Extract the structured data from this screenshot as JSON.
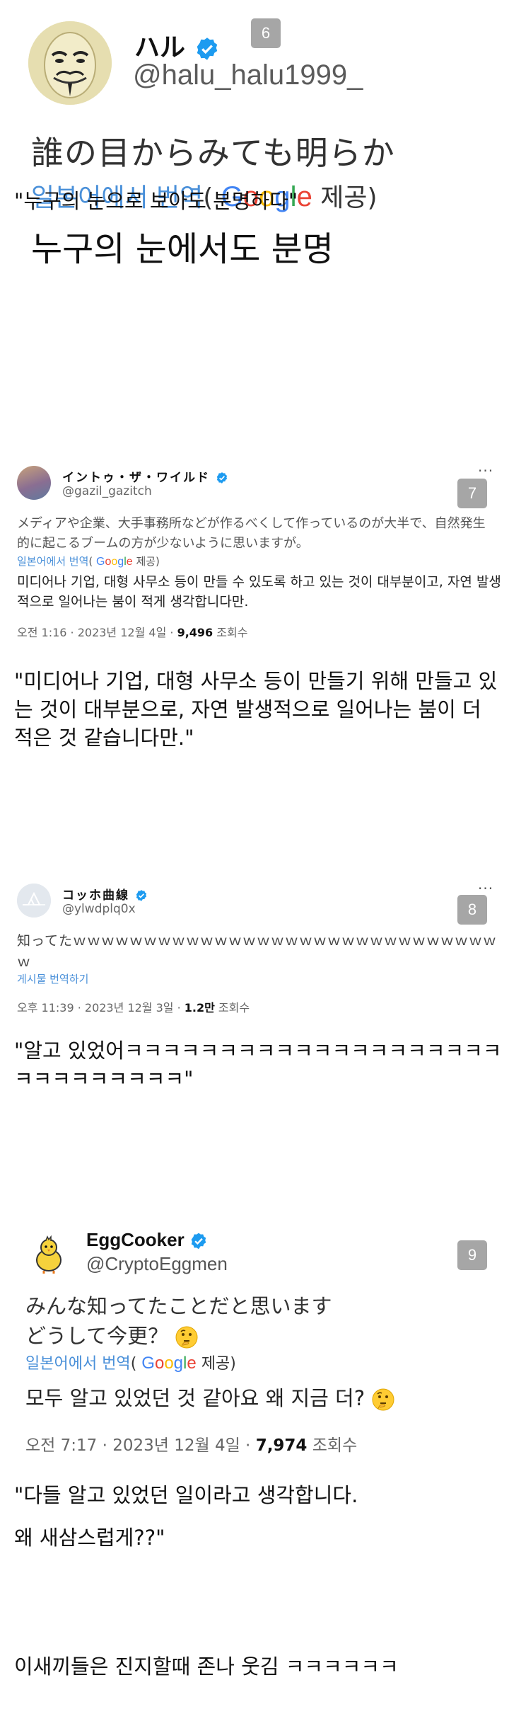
{
  "tweet1": {
    "name": "ハル",
    "handle": "@halu_halu1999_",
    "badge": "6",
    "original": "誰の目からみても明らか",
    "translated_from": "일본어에서 번역",
    "provided_by_prefix": "(",
    "provided_by_suffix": "제공)",
    "translation": "누구의 눈에서도 분명",
    "caption": "\"누구의 눈으로 보아도 분명하다\""
  },
  "tweet2": {
    "name": "イントゥ・ザ・ワイルド",
    "handle": "@gazil_gazitch",
    "badge": "7",
    "more": "···",
    "original": "メディアや企業、大手事務所などが作るべくして作っているのが大半で、自然発生的に起こるブームの方が少ないように思いますが。",
    "translated_from": "일본어에서 번역",
    "provided_by_prefix": "(",
    "provided_by_suffix": "제공)",
    "translation": "미디어나 기업, 대형 사무소 등이 만들 수 있도록 하고 있는 것이 대부분이고, 자연 발생적으로 일어나는 붐이 적게 생각합니다만.",
    "meta_time": "오전 1:16 · 2023년 12월 4일 · ",
    "meta_views": "9,496",
    "meta_views_label": " 조회수",
    "caption": "\"미디어나 기업, 대형 사무소 등이 만들기 위해 만들고 있는 것이 대부분으로, 자연 발생적으로 일어나는 붐이 더 적은 것 같습니다만.\""
  },
  "tweet3": {
    "name": "コッホ曲線",
    "handle": "@ylwdplq0x",
    "badge": "8",
    "more": "···",
    "original": "知ってたｗｗｗｗｗｗｗｗｗｗｗｗｗｗｗｗｗｗｗｗｗｗｗｗｗｗｗｗｗｗｗ",
    "translate_link": "게시물 번역하기",
    "meta_time": "오후 11:39 · 2023년 12월 3일 · ",
    "meta_views": "1.2만",
    "meta_views_label": " 조회수",
    "caption": "\"알고 있었어ㅋㅋㅋㅋㅋㅋㅋㅋㅋㅋㅋㅋㅋㅋㅋㅋㅋㅋㅋㅋㅋㅋㅋㅋㅋㅋㅋㅋㅋ\""
  },
  "tweet4": {
    "name": "EggCooker",
    "handle": "@CryptoEggmen",
    "badge": "9",
    "original_line1": "みんな知ってたことだと思います",
    "original_line2": "どうして今更？",
    "translated_from": "일본어에서 번역",
    "provided_by_prefix": "(",
    "provided_by_suffix": "제공)",
    "translation": "모두 알고 있었던 것 같아요 왜 지금 더?",
    "meta_time": "오전 7:17 · 2023년 12월 4일 · ",
    "meta_views": "7,974",
    "meta_views_label": " 조회수",
    "caption_line1": "\"다들 알고 있었던 일이라고 생각합니다.",
    "caption_line2": "왜 새삼스럽게??\""
  },
  "footer": {
    "comment": "이새끼들은 진지할때 존나 웃김 ㅋㅋㅋㅋㅋㅋ"
  },
  "google_letters": [
    "G",
    "o",
    "o",
    "g",
    "l",
    "e"
  ],
  "colors": {
    "verified": "#1d9bf0",
    "badge": "#a6a6a6",
    "translate_link": "#4a90d9"
  }
}
